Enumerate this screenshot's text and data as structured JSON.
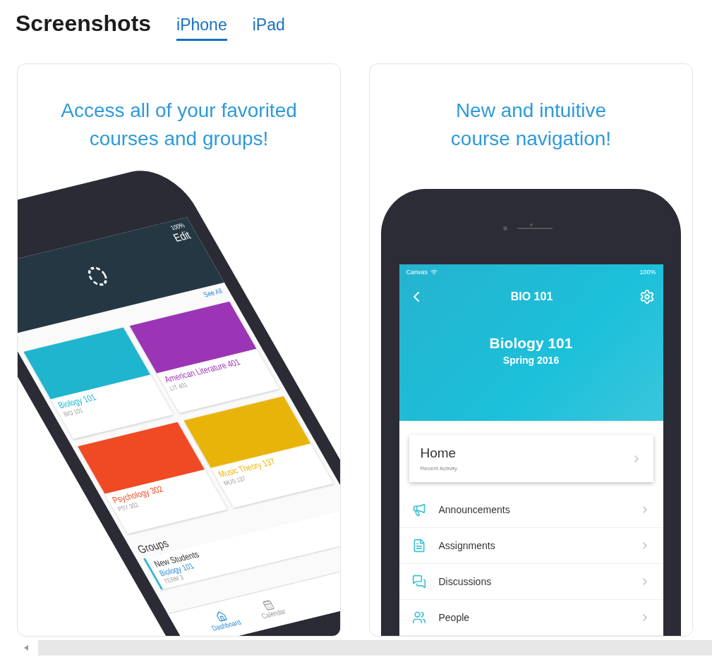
{
  "section_title": "Screenshots",
  "tabs": [
    {
      "label": "iPhone",
      "selected": true
    },
    {
      "label": "iPad",
      "selected": false
    }
  ],
  "screenshots": [
    {
      "kind": "dashboard",
      "caption": "Access all of your favorited courses and groups!",
      "phone": {
        "battery": "100%",
        "edit": "Edit",
        "see_all": "See All",
        "courses": [
          {
            "name": "Biology 101",
            "code": "BIO 101",
            "color": "#1fb5cf"
          },
          {
            "name": "American Literature 401",
            "code": "LIT 401",
            "color": "#9b35b5"
          },
          {
            "name": "Psychology 302",
            "code": "PSY 302",
            "color": "#ef4a24"
          },
          {
            "name": "Music Theory 137",
            "code": "MUS 137",
            "color": "#e9b40a"
          }
        ],
        "groups_title": "Groups",
        "groups": [
          {
            "name": "New Students",
            "course": "Biology 101",
            "term": "TERM 3"
          }
        ],
        "tab_bar": [
          {
            "label": "Dashboard",
            "selected": true
          },
          {
            "label": "Calendar",
            "selected": false
          }
        ]
      }
    },
    {
      "kind": "course",
      "caption": "New and intuitive course navigation!",
      "phone": {
        "carrier": "Canvas",
        "battery": "100%",
        "title": "BIO 101",
        "course_name": "Biology 101",
        "term": "Spring 2016",
        "home": {
          "title": "Home",
          "subtitle": "Recent Activity"
        },
        "nav": [
          {
            "label": "Announcements"
          },
          {
            "label": "Assignments"
          },
          {
            "label": "Discussions"
          },
          {
            "label": "People"
          }
        ]
      }
    }
  ]
}
